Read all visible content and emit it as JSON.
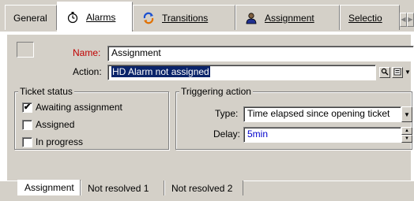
{
  "tabs": [
    {
      "label": "General"
    },
    {
      "label": "Alarms",
      "underline": "A",
      "icon": "stopwatch-icon"
    },
    {
      "label": "Transitions",
      "underline": "T",
      "icon": "cycle-arrows-icon"
    },
    {
      "label": "Assignment",
      "underline": "A",
      "icon": "person-icon"
    },
    {
      "label": "Selectio",
      "underline": "S"
    }
  ],
  "form": {
    "name_label": "Name:",
    "name_value": "Assignment",
    "action_label": "Action:",
    "action_value": "HD Alarm not assigned"
  },
  "ticket_status": {
    "title": "Ticket status",
    "items": [
      {
        "label": "Awaiting assignment",
        "checked": true
      },
      {
        "label": "Assigned",
        "checked": false
      },
      {
        "label": "In progress",
        "checked": false
      }
    ]
  },
  "triggering_action": {
    "title": "Triggering action",
    "type_label": "Type:",
    "type_value": "Time elapsed since opening ticket",
    "delay_label": "Delay:",
    "delay_value": "5min"
  },
  "bottom_tabs": [
    {
      "label": "Assignment"
    },
    {
      "label": "Not resolved 1"
    },
    {
      "label": "Not resolved 2"
    }
  ],
  "colors": {
    "background": "#d4d0c8",
    "selection": "#0a246a",
    "required_label": "#c00000",
    "delay_value": "#0000cc"
  }
}
